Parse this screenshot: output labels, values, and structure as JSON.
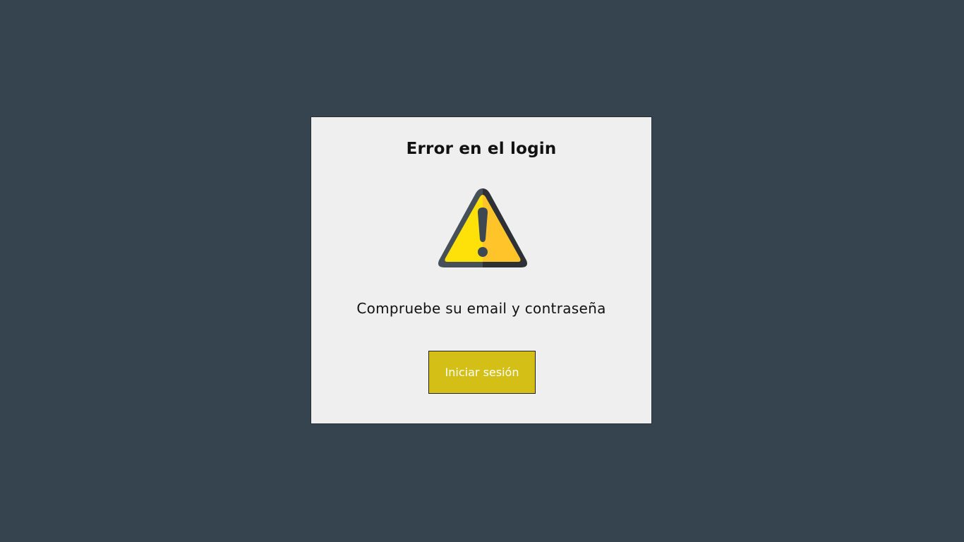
{
  "dialog": {
    "title": "Error en el login",
    "message": "Compruebe su email y contraseña",
    "button_label": "Iniciar sesión",
    "icon": "warning-triangle-icon"
  },
  "colors": {
    "background": "#35444f",
    "dialog_background": "#efefef",
    "button_background": "#d4bf17",
    "icon_fill_left": "#ffe10a",
    "icon_fill_right": "#ffc42a",
    "icon_border_left": "#455059",
    "icon_border_right": "#2d3135"
  }
}
